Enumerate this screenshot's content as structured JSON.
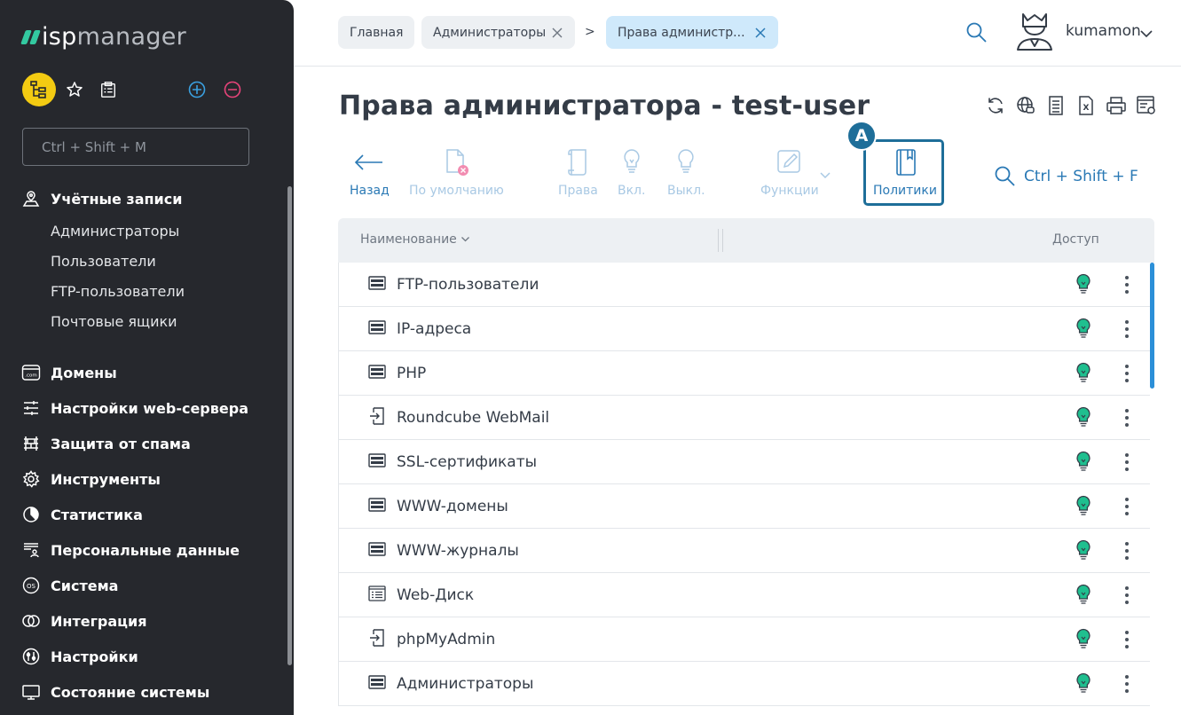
{
  "app": {
    "logo_primary": "isp",
    "logo_secondary": "manager"
  },
  "sidebar": {
    "search_placeholder": "Ctrl + Shift + M",
    "sections": [
      {
        "label": "Учётные записи",
        "icon": "user-pin-icon"
      },
      {
        "label": "Домены",
        "icon": "domain-icon"
      },
      {
        "label": "Настройки web-сервера",
        "icon": "sliders-icon"
      },
      {
        "label": "Защита от спама",
        "icon": "firewall-icon"
      },
      {
        "label": "Инструменты",
        "icon": "gear-icon"
      },
      {
        "label": "Статистика",
        "icon": "pie-chart-icon"
      },
      {
        "label": "Персональные данные",
        "icon": "personal-data-icon"
      },
      {
        "label": "Система",
        "icon": "os-icon"
      },
      {
        "label": "Интеграция",
        "icon": "integration-icon"
      },
      {
        "label": "Настройки",
        "icon": "settings-icon"
      },
      {
        "label": "Состояние системы",
        "icon": "monitor-icon"
      }
    ],
    "accounts_items": [
      {
        "label": "Администраторы"
      },
      {
        "label": "Пользователи"
      },
      {
        "label": "FTP-пользователи"
      },
      {
        "label": "Почтовые ящики"
      }
    ]
  },
  "header": {
    "breadcrumbs": [
      {
        "label": "Главная"
      },
      {
        "label": "Администраторы"
      },
      {
        "label": "Права администр..."
      }
    ],
    "breadcrumb_separator": ">",
    "username": "kumamon"
  },
  "page": {
    "title": "Права администратора - test-user"
  },
  "toolbar": {
    "back": "Назад",
    "default": "По умолчанию",
    "rights": "Права",
    "enable": "Вкл.",
    "disable": "Выкл.",
    "functions": "Функции",
    "policies": "Политики",
    "search_hotkey": "Ctrl + Shift + F",
    "annotation_label": "A"
  },
  "table": {
    "col_name": "Наименование",
    "col_access": "Доступ",
    "rows": [
      {
        "name": "FTP-пользователи",
        "icon": "table-icon"
      },
      {
        "name": "IP-адреса",
        "icon": "table-icon"
      },
      {
        "name": "PHP",
        "icon": "table-icon"
      },
      {
        "name": "Roundcube WebMail",
        "icon": "external-link-icon"
      },
      {
        "name": "SSL-сертификаты",
        "icon": "table-icon"
      },
      {
        "name": "WWW-домены",
        "icon": "table-icon"
      },
      {
        "name": "WWW-журналы",
        "icon": "table-icon"
      },
      {
        "name": "Web-Диск",
        "icon": "form-icon"
      },
      {
        "name": "phpMyAdmin",
        "icon": "external-link-icon"
      },
      {
        "name": "Администраторы",
        "icon": "table-icon"
      }
    ]
  },
  "colors": {
    "sidebar_bg": "#26282d",
    "accent_blue": "#2a79b5",
    "bulb_green": "#1fbf8f",
    "highlight": "#1e6e99",
    "logo_green": "#33c9a0"
  }
}
